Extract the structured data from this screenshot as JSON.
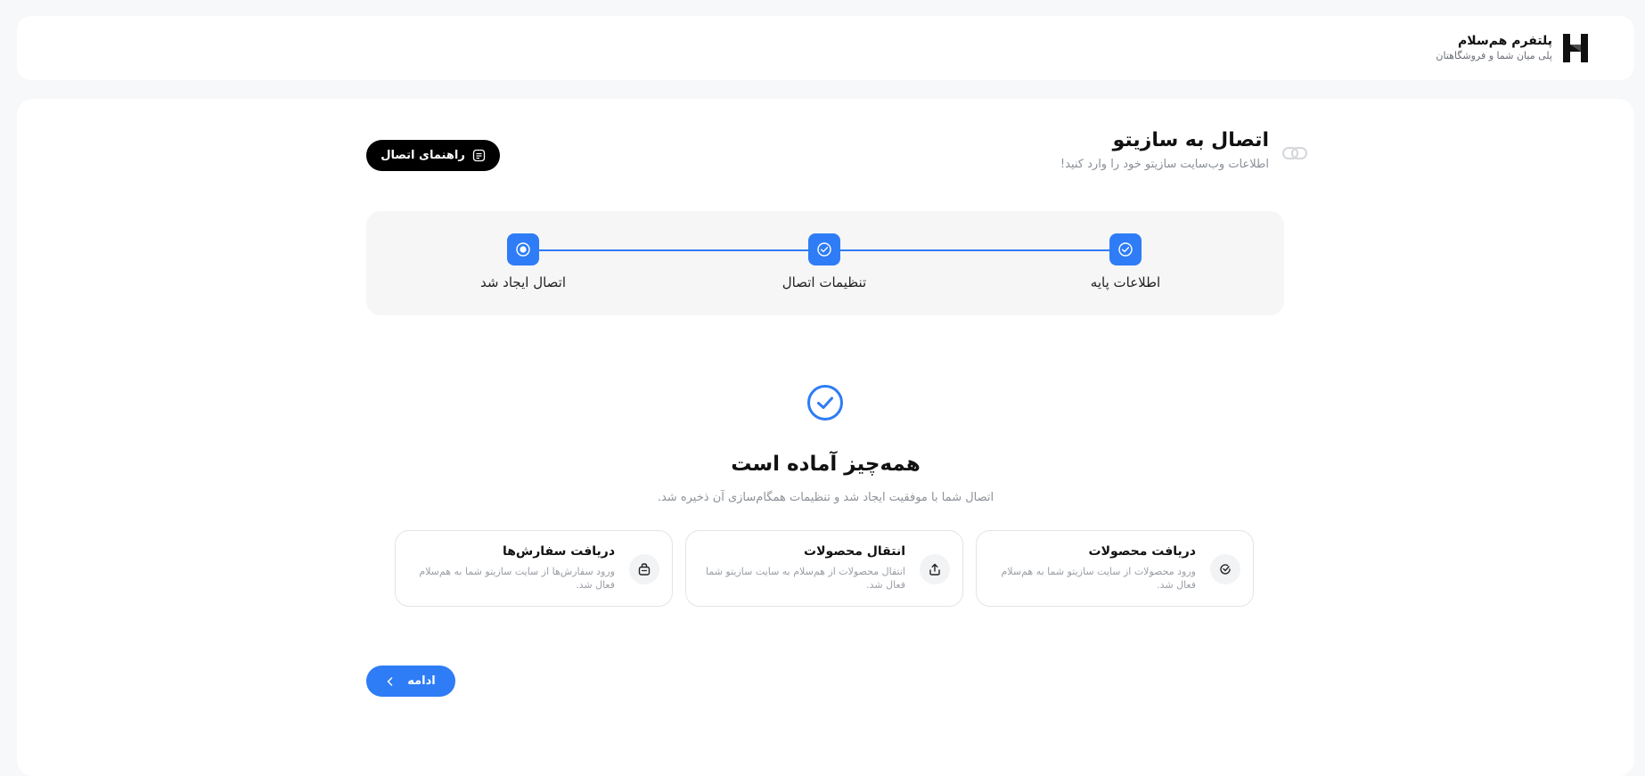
{
  "header": {
    "brand_title": "پلتفرم هم‌سلام",
    "brand_subtitle": "پلی میان شما و فروشگاهتان"
  },
  "page": {
    "title": "اتصال به سازیتو",
    "subtitle": "اطلاعات وب‌سایت سازیتو خود را وارد کنید!",
    "guide_button": "راهنمای اتصال"
  },
  "stepper": {
    "steps": [
      {
        "label": "اطلاعات پایه",
        "state": "done"
      },
      {
        "label": "تنظیمات اتصال",
        "state": "done"
      },
      {
        "label": "اتصال ایجاد شد",
        "state": "current"
      }
    ]
  },
  "success": {
    "title": "همه‌چیز آماده است",
    "subtitle": "اتصال شما با موفقیت ایجاد شد و تنظیمات همگام‌سازی آن ذخیره شد."
  },
  "features": [
    {
      "title": "دریافت محصولات",
      "desc": "ورود محصولات از سایت سازیتو شما به هم‌سلام فعال شد.",
      "icon": "refresh-icon"
    },
    {
      "title": "انتقال محصولات",
      "desc": "انتقال محصولات از هم‌سلام به سایت سازیتو شما فعال شد.",
      "icon": "upload-icon"
    },
    {
      "title": "دریافت سفارش‌ها",
      "desc": "ورود سفارش‌ها از سایت سازیتو شما به هم‌سلام فعال شد.",
      "icon": "shopping-bag-icon"
    }
  ],
  "actions": {
    "continue_label": "ادامه"
  },
  "colors": {
    "accent": "#2e7cf6",
    "dark_button": "#000000"
  }
}
